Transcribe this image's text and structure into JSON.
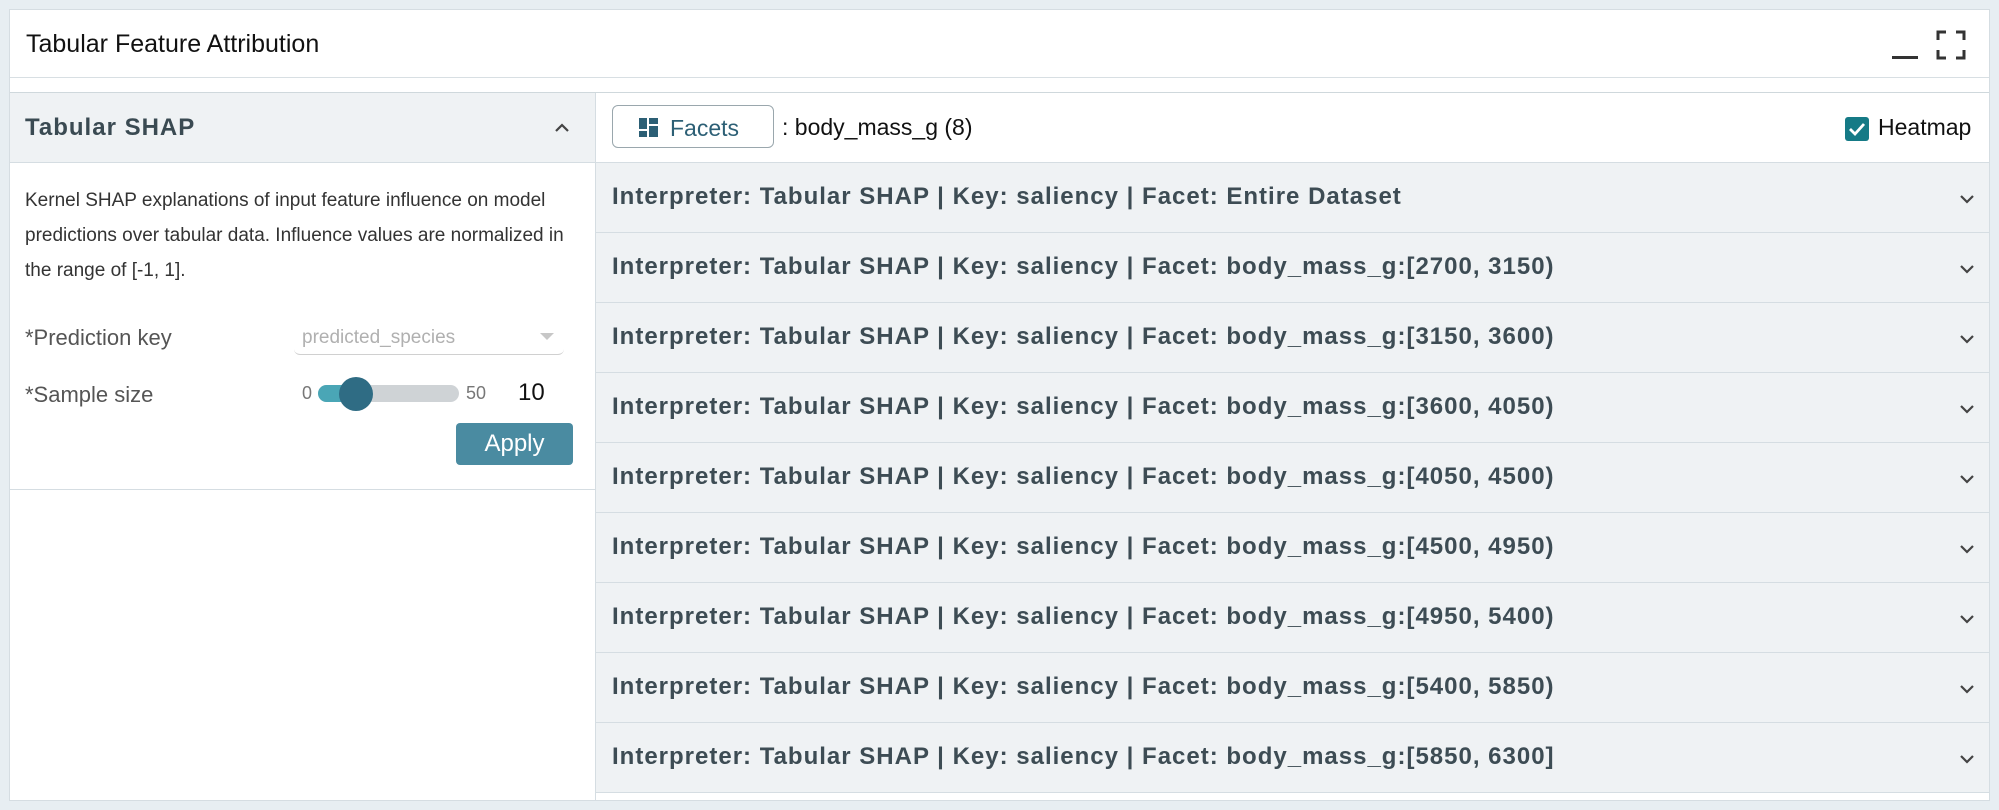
{
  "module": {
    "title": "Tabular Feature Attribution",
    "minimize_icon": "minimize-icon",
    "maximize_icon": "fullscreen-icon"
  },
  "interpreter_panel": {
    "title": "Tabular SHAP",
    "collapse_icon": "chevron-up-icon",
    "description": "Kernel SHAP explanations of input feature influence on model predictions over tabular data. Influence values are normalized in the range of [-1, 1].",
    "prediction_key": {
      "label": "*Prediction key",
      "value": "predicted_species"
    },
    "sample_size": {
      "label": "*Sample size",
      "min": "0",
      "max": "50",
      "value": "10",
      "fraction": 0.2
    },
    "apply_label": "Apply"
  },
  "toolbar": {
    "facets_label": "Facets",
    "facets_icon": "dashboard-grid-icon",
    "facet_summary": ": body_mass_g (8)",
    "heatmap_label": "Heatmap",
    "heatmap_checked": true
  },
  "rows": [
    {
      "label": "Interpreter: Tabular SHAP | Key: saliency | Facet: Entire Dataset"
    },
    {
      "label": "Interpreter: Tabular SHAP | Key: saliency | Facet: body_mass_g:[2700, 3150)"
    },
    {
      "label": "Interpreter: Tabular SHAP | Key: saliency | Facet: body_mass_g:[3150, 3600)"
    },
    {
      "label": "Interpreter: Tabular SHAP | Key: saliency | Facet: body_mass_g:[3600, 4050)"
    },
    {
      "label": "Interpreter: Tabular SHAP | Key: saliency | Facet: body_mass_g:[4050, 4500)"
    },
    {
      "label": "Interpreter: Tabular SHAP | Key: saliency | Facet: body_mass_g:[4500, 4950)"
    },
    {
      "label": "Interpreter: Tabular SHAP | Key: saliency | Facet: body_mass_g:[4950, 5400)"
    },
    {
      "label": "Interpreter: Tabular SHAP | Key: saliency | Facet: body_mass_g:[5400, 5850)"
    },
    {
      "label": "Interpreter: Tabular SHAP | Key: saliency | Facet: body_mass_g:[5850, 6300]"
    }
  ],
  "colors": {
    "accent": "#4a8ba1",
    "checkbox": "#157a86",
    "slider_thumb": "#2f6c84",
    "slider_fill": "#4aa6b6"
  }
}
